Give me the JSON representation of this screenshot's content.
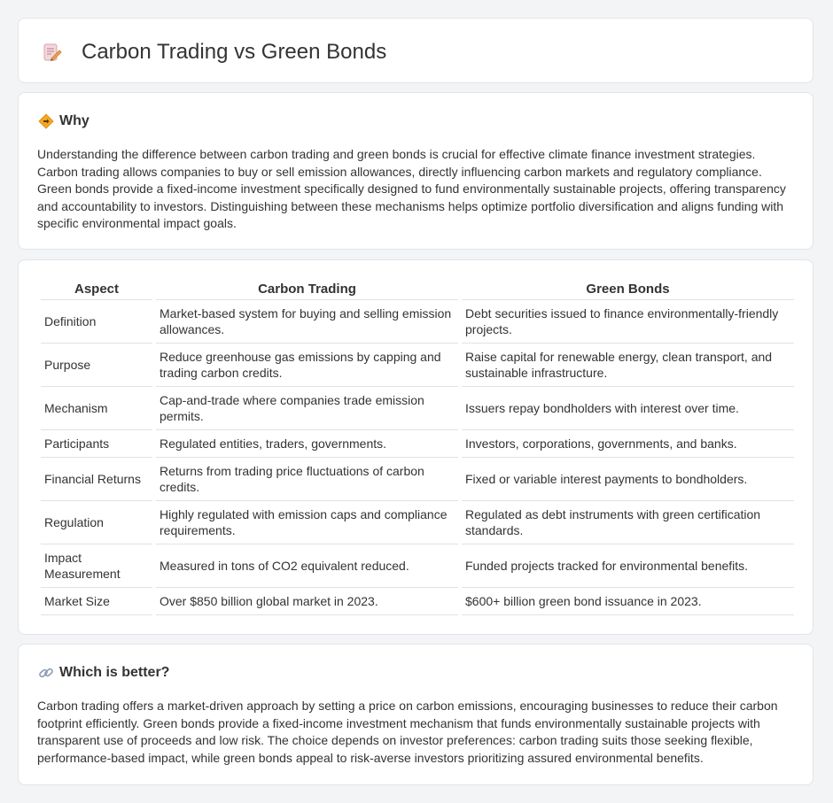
{
  "page": {
    "title": "Carbon Trading vs Green Bonds",
    "title_icon": "memo-pencil-icon"
  },
  "why": {
    "heading": "Why",
    "icon": "signpost-icon",
    "text": "Understanding the difference between carbon trading and green bonds is crucial for effective climate finance investment strategies. Carbon trading allows companies to buy or sell emission allowances, directly influencing carbon markets and regulatory compliance. Green bonds provide a fixed-income investment specifically designed to fund environmentally sustainable projects, offering transparency and accountability to investors. Distinguishing between these mechanisms helps optimize portfolio diversification and aligns funding with specific environmental impact goals."
  },
  "table": {
    "headers": [
      "Aspect",
      "Carbon Trading",
      "Green Bonds"
    ],
    "rows": [
      {
        "aspect": "Definition",
        "carbon": "Market-based system for buying and selling emission allowances.",
        "green": "Debt securities issued to finance environmentally-friendly projects."
      },
      {
        "aspect": "Purpose",
        "carbon": "Reduce greenhouse gas emissions by capping and trading carbon credits.",
        "green": "Raise capital for renewable energy, clean transport, and sustainable infrastructure."
      },
      {
        "aspect": "Mechanism",
        "carbon": "Cap-and-trade where companies trade emission permits.",
        "green": "Issuers repay bondholders with interest over time."
      },
      {
        "aspect": "Participants",
        "carbon": "Regulated entities, traders, governments.",
        "green": "Investors, corporations, governments, and banks."
      },
      {
        "aspect": "Financial Returns",
        "carbon": "Returns from trading price fluctuations of carbon credits.",
        "green": "Fixed or variable interest payments to bondholders."
      },
      {
        "aspect": "Regulation",
        "carbon": "Highly regulated with emission caps and compliance requirements.",
        "green": "Regulated as debt instruments with green certification standards."
      },
      {
        "aspect": "Impact Measurement",
        "carbon": "Measured in tons of CO2 equivalent reduced.",
        "green": "Funded projects tracked for environmental benefits."
      },
      {
        "aspect": "Market Size",
        "carbon": "Over $850 billion global market in 2023.",
        "green": "$600+ billion green bond issuance in 2023."
      }
    ]
  },
  "better": {
    "heading": "Which is better?",
    "icon": "link-icon",
    "text": "Carbon trading offers a market-driven approach by setting a price on carbon emissions, encouraging businesses to reduce their carbon footprint efficiently. Green bonds provide a fixed-income investment mechanism that funds environmentally sustainable projects with transparent use of proceeds and low risk. The choice depends on investor preferences: carbon trading suits those seeking flexible, performance-based impact, while green bonds appeal to risk-averse investors prioritizing assured environmental benefits."
  }
}
